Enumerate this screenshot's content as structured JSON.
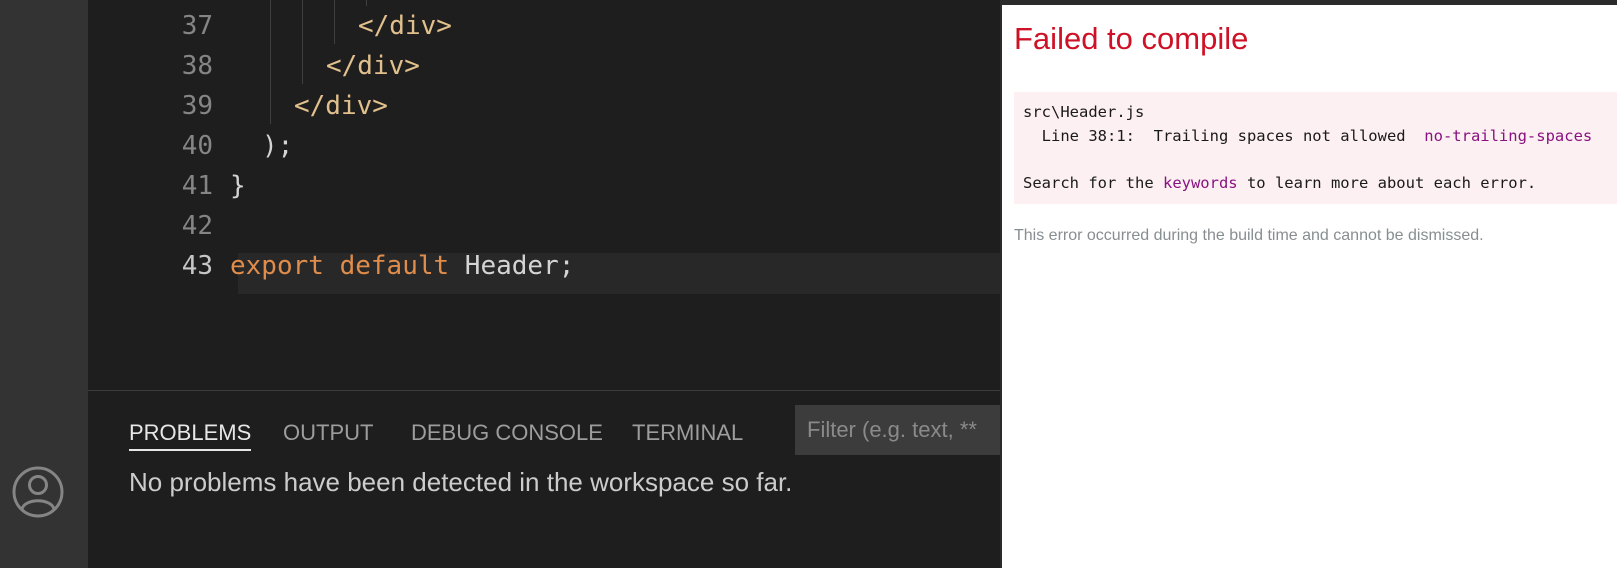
{
  "editor": {
    "lines": [
      {
        "num": "37",
        "tokens": [
          {
            "text": "</div>",
            "cls": "tk-tag"
          }
        ]
      },
      {
        "num": "38",
        "tokens": [
          {
            "text": "</div>",
            "cls": "tk-tag"
          }
        ]
      },
      {
        "num": "39",
        "tokens": [
          {
            "text": "</div>",
            "cls": "tk-tag"
          }
        ]
      },
      {
        "num": "40",
        "tokens": [
          {
            "text": ");",
            "cls": "tk-id"
          }
        ]
      },
      {
        "num": "41",
        "tokens": [
          {
            "text": "}",
            "cls": "tk-id"
          }
        ]
      },
      {
        "num": "42",
        "tokens": []
      },
      {
        "num": "43",
        "tokens": [
          {
            "text": "export",
            "cls": "tk-kw"
          },
          {
            "text": " ",
            "cls": "tk-id"
          },
          {
            "text": "default",
            "cls": "tk-kw"
          },
          {
            "text": " Header;",
            "cls": "tk-id"
          }
        ]
      }
    ],
    "active_line": "43"
  },
  "panel": {
    "tabs": [
      "PROBLEMS",
      "OUTPUT",
      "DEBUG CONSOLE",
      "TERMINAL"
    ],
    "active_tab": "PROBLEMS",
    "filter_placeholder": "Filter (e.g. text, **",
    "message": "No problems have been detected in the workspace so far."
  },
  "overlay": {
    "title": "Failed to compile",
    "file": "src\\Header.js",
    "error_prefix": "  Line 38:1:  Trailing spaces not allowed  ",
    "rule": "no-trailing-spaces",
    "search_before": "Search for the ",
    "search_link": "keywords",
    "search_after": " to learn more about each error.",
    "footer": "This error occurred during the build time and cannot be dismissed."
  },
  "colors": {
    "accent_error": "#ce1126",
    "rule_purple": "#881280",
    "editor_bg": "#1e1e1e"
  },
  "icons": {
    "account": "account-icon"
  }
}
